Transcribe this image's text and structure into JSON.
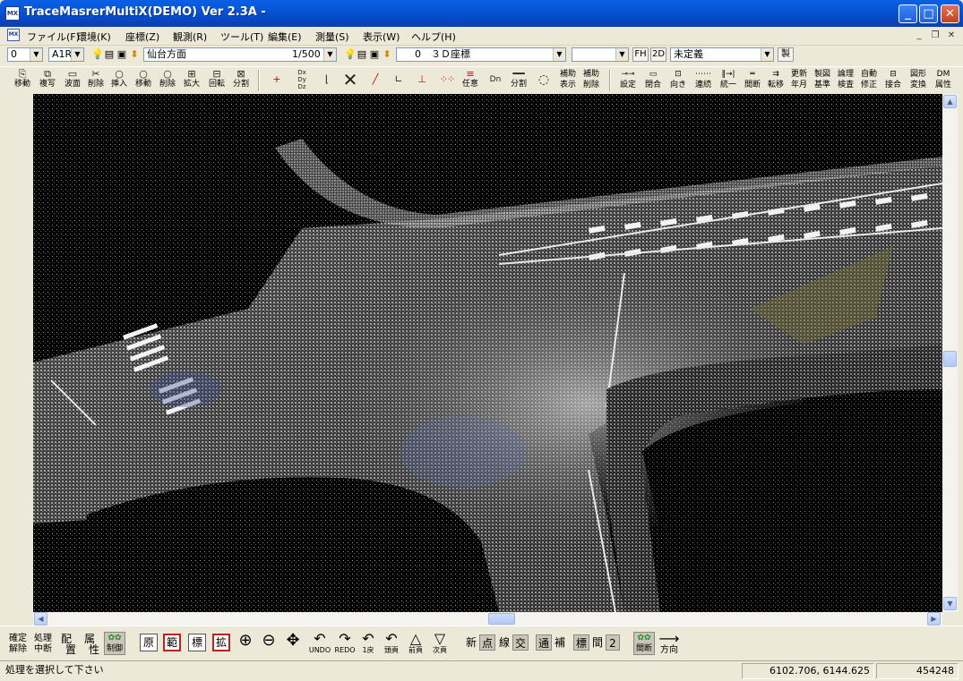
{
  "window": {
    "title": "TraceMasrerMultiX(DEMO) Ver 2.3A -",
    "app_icon_label": "MX",
    "minimize_glyph": "_",
    "maximize_glyph": "□",
    "close_glyph": "✕"
  },
  "menu": {
    "items": [
      "ファイル(F)",
      "環境(K)",
      "座標(Z)",
      "観測(R)",
      "ツール(T)",
      "編集(E)",
      "測量(S)",
      "表示(W)",
      "ヘルプ(H)"
    ],
    "mdi_min": "_",
    "mdi_restore": "❐",
    "mdi_close": "✕"
  },
  "toolbar1": {
    "layer_num": "0",
    "layer_code": "A1R",
    "layer_name": "仙台方面",
    "scale": "1/500",
    "coord_num": "0",
    "coord_name": "３Ｄ座標",
    "empty_combo": "",
    "fh_label": "FH",
    "view_label": "2D",
    "attr_combo": "未定義",
    "make_label": "製"
  },
  "toolbar2": {
    "left_tools": [
      {
        "icon": "move-icon",
        "label": "移動"
      },
      {
        "icon": "copy-icon",
        "label": "複写"
      },
      {
        "icon": "wave-delete-icon",
        "label": "波面"
      },
      {
        "icon": "delete-icon",
        "label": "削除"
      },
      {
        "icon": "insert-icon",
        "label": "挿入"
      },
      {
        "icon": "point-move-icon",
        "label": "移動"
      },
      {
        "icon": "point-delete-icon",
        "label": "削除"
      },
      {
        "icon": "expand-icon",
        "label": "拡大"
      },
      {
        "icon": "rotate-icon",
        "label": "回転"
      },
      {
        "icon": "split-icon",
        "label": "分割"
      }
    ],
    "mid_labels": {
      "arbitrary": "任意",
      "split": "分割",
      "aux_show_1": "補助",
      "aux_show_2": "表示",
      "aux_del_1": "補助",
      "aux_del_2": "削除"
    },
    "right_tools": [
      {
        "l1": "設定",
        "l2": ""
      },
      {
        "l1": "閉合",
        "l2": ""
      },
      {
        "l1": "向き",
        "l2": ""
      },
      {
        "l1": "連続",
        "l2": ""
      },
      {
        "l1": "統一",
        "l2": ""
      },
      {
        "l1": "間断",
        "l2": ""
      },
      {
        "l1": "転移",
        "l2": ""
      },
      {
        "l1": "更新",
        "l2": "年月"
      },
      {
        "l1": "製図",
        "l2": "基準"
      },
      {
        "l1": "論理",
        "l2": "検査"
      },
      {
        "l1": "自動",
        "l2": "修正"
      },
      {
        "l1": "接合",
        "l2": ""
      },
      {
        "l1": "図形",
        "l2": "変換"
      },
      {
        "l1": "DM",
        "l2": "属性"
      }
    ]
  },
  "bottom": {
    "confirm_1": "確定",
    "confirm_2": "解除",
    "process_1": "処理",
    "process_2": "中断",
    "place_1": "配",
    "place_2": "置",
    "attr_1": "属",
    "attr_2": "性",
    "control_label": "制御",
    "box_hara": "原",
    "box_han": "範",
    "box_hyo": "標",
    "box_kaku": "拡",
    "undo": "UNDO",
    "redo": "REDO",
    "back1": "1戻",
    "first_page": "頭頁",
    "prev_page": "前頁",
    "next_page": "次頁",
    "modes": [
      "新",
      "点",
      "線",
      "交"
    ],
    "modes2": [
      "通",
      "補"
    ],
    "modes3": [
      "標",
      "間",
      "2"
    ],
    "gap_label": "間断",
    "dir_label": "方向"
  },
  "status": {
    "message": "処理を選択して下さい",
    "coords": "6102.706,    6144.625",
    "count": "454248"
  }
}
